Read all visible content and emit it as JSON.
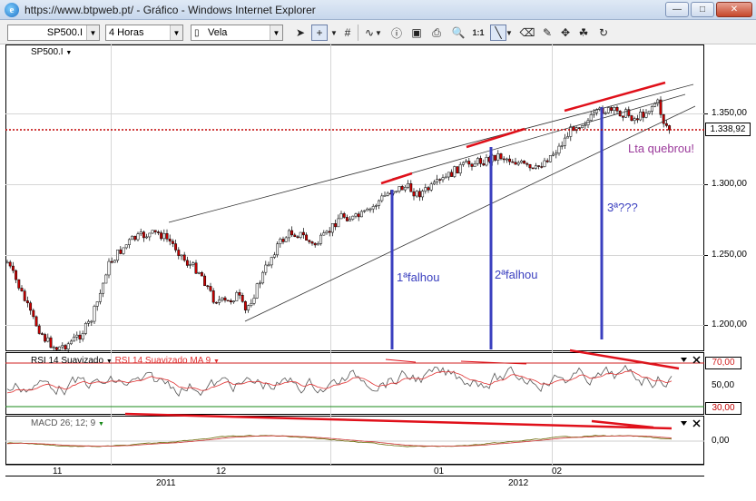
{
  "window": {
    "title": "https://www.btpweb.pt/ - Gráfico - Windows Internet Explorer",
    "ie_icon": "internet-explorer-icon",
    "minimize_icon": "minimize-icon",
    "maximize_icon": "maximize-icon",
    "close_icon": "close-icon"
  },
  "toolbar": {
    "symbol": "SP500.I",
    "period": "4 Horas",
    "chart_type": "Vela",
    "zoom_label": "1:1",
    "icons": [
      "pointer-icon",
      "crosshair-icon",
      "grid-icon",
      "wave-icon",
      "info-icon",
      "save-icon",
      "print-icon",
      "zoom-icon",
      "zoom-reset-icon",
      "line-draw-icon",
      "eraser-icon",
      "pencil-icon",
      "drag-icon",
      "tree-icon",
      "refresh-icon"
    ]
  },
  "main_panel": {
    "symbol_label": "SP500.I",
    "y_ticks": [
      "1.350,00",
      "1.300,00",
      "1.250,00",
      "1.200,00"
    ],
    "last_price": "1.338,92",
    "annotations": {
      "lta": "Lta quebrou!",
      "first": "1ªfalhou",
      "second": "2ªfalhou",
      "third": "3ª???"
    }
  },
  "rsi_panel": {
    "label": "RSI 14 Suavizado",
    "label_ma": "RSI 14 Suavizado MA 9",
    "y_ticks": [
      "70,00",
      "50,00",
      "30,00"
    ]
  },
  "macd_panel": {
    "label": "MACD 26; 12; 9",
    "y_ticks": [
      "0,00"
    ]
  },
  "time_axis": {
    "months": [
      "11",
      "12",
      "01",
      "02"
    ],
    "years": [
      "2011",
      "2012"
    ]
  },
  "colors": {
    "candle_body": "#000000",
    "candle_up": "#ffffff",
    "candle_down": "#cc0000",
    "trend_red": "#e0101a",
    "vertical_blue": "#3a3fbf",
    "annotation_purple": "#9b3a9b",
    "annotation_blue": "#3a3fbf",
    "rsi_ma": "#e03030",
    "macd_line": "#666600"
  }
}
